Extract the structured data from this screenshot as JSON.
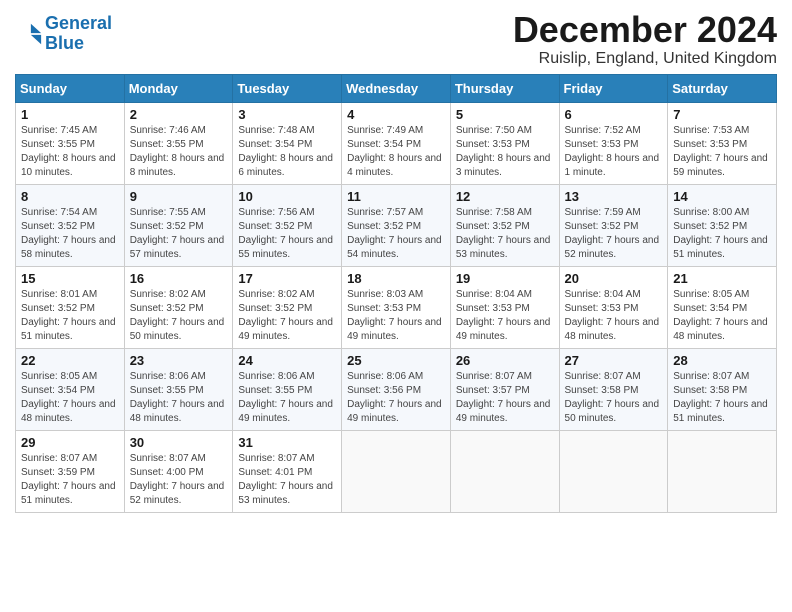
{
  "logo": {
    "line1": "General",
    "line2": "Blue"
  },
  "title": "December 2024",
  "subtitle": "Ruislip, England, United Kingdom",
  "header": {
    "accent_color": "#2980b9"
  },
  "weekdays": [
    "Sunday",
    "Monday",
    "Tuesday",
    "Wednesday",
    "Thursday",
    "Friday",
    "Saturday"
  ],
  "weeks": [
    [
      {
        "day": "1",
        "sunrise": "7:45 AM",
        "sunset": "3:55 PM",
        "daylight": "8 hours and 10 minutes."
      },
      {
        "day": "2",
        "sunrise": "7:46 AM",
        "sunset": "3:55 PM",
        "daylight": "8 hours and 8 minutes."
      },
      {
        "day": "3",
        "sunrise": "7:48 AM",
        "sunset": "3:54 PM",
        "daylight": "8 hours and 6 minutes."
      },
      {
        "day": "4",
        "sunrise": "7:49 AM",
        "sunset": "3:54 PM",
        "daylight": "8 hours and 4 minutes."
      },
      {
        "day": "5",
        "sunrise": "7:50 AM",
        "sunset": "3:53 PM",
        "daylight": "8 hours and 3 minutes."
      },
      {
        "day": "6",
        "sunrise": "7:52 AM",
        "sunset": "3:53 PM",
        "daylight": "8 hours and 1 minute."
      },
      {
        "day": "7",
        "sunrise": "7:53 AM",
        "sunset": "3:53 PM",
        "daylight": "7 hours and 59 minutes."
      }
    ],
    [
      {
        "day": "8",
        "sunrise": "7:54 AM",
        "sunset": "3:52 PM",
        "daylight": "7 hours and 58 minutes."
      },
      {
        "day": "9",
        "sunrise": "7:55 AM",
        "sunset": "3:52 PM",
        "daylight": "7 hours and 57 minutes."
      },
      {
        "day": "10",
        "sunrise": "7:56 AM",
        "sunset": "3:52 PM",
        "daylight": "7 hours and 55 minutes."
      },
      {
        "day": "11",
        "sunrise": "7:57 AM",
        "sunset": "3:52 PM",
        "daylight": "7 hours and 54 minutes."
      },
      {
        "day": "12",
        "sunrise": "7:58 AM",
        "sunset": "3:52 PM",
        "daylight": "7 hours and 53 minutes."
      },
      {
        "day": "13",
        "sunrise": "7:59 AM",
        "sunset": "3:52 PM",
        "daylight": "7 hours and 52 minutes."
      },
      {
        "day": "14",
        "sunrise": "8:00 AM",
        "sunset": "3:52 PM",
        "daylight": "7 hours and 51 minutes."
      }
    ],
    [
      {
        "day": "15",
        "sunrise": "8:01 AM",
        "sunset": "3:52 PM",
        "daylight": "7 hours and 51 minutes."
      },
      {
        "day": "16",
        "sunrise": "8:02 AM",
        "sunset": "3:52 PM",
        "daylight": "7 hours and 50 minutes."
      },
      {
        "day": "17",
        "sunrise": "8:02 AM",
        "sunset": "3:52 PM",
        "daylight": "7 hours and 49 minutes."
      },
      {
        "day": "18",
        "sunrise": "8:03 AM",
        "sunset": "3:53 PM",
        "daylight": "7 hours and 49 minutes."
      },
      {
        "day": "19",
        "sunrise": "8:04 AM",
        "sunset": "3:53 PM",
        "daylight": "7 hours and 49 minutes."
      },
      {
        "day": "20",
        "sunrise": "8:04 AM",
        "sunset": "3:53 PM",
        "daylight": "7 hours and 48 minutes."
      },
      {
        "day": "21",
        "sunrise": "8:05 AM",
        "sunset": "3:54 PM",
        "daylight": "7 hours and 48 minutes."
      }
    ],
    [
      {
        "day": "22",
        "sunrise": "8:05 AM",
        "sunset": "3:54 PM",
        "daylight": "7 hours and 48 minutes."
      },
      {
        "day": "23",
        "sunrise": "8:06 AM",
        "sunset": "3:55 PM",
        "daylight": "7 hours and 48 minutes."
      },
      {
        "day": "24",
        "sunrise": "8:06 AM",
        "sunset": "3:55 PM",
        "daylight": "7 hours and 49 minutes."
      },
      {
        "day": "25",
        "sunrise": "8:06 AM",
        "sunset": "3:56 PM",
        "daylight": "7 hours and 49 minutes."
      },
      {
        "day": "26",
        "sunrise": "8:07 AM",
        "sunset": "3:57 PM",
        "daylight": "7 hours and 49 minutes."
      },
      {
        "day": "27",
        "sunrise": "8:07 AM",
        "sunset": "3:58 PM",
        "daylight": "7 hours and 50 minutes."
      },
      {
        "day": "28",
        "sunrise": "8:07 AM",
        "sunset": "3:58 PM",
        "daylight": "7 hours and 51 minutes."
      }
    ],
    [
      {
        "day": "29",
        "sunrise": "8:07 AM",
        "sunset": "3:59 PM",
        "daylight": "7 hours and 51 minutes."
      },
      {
        "day": "30",
        "sunrise": "8:07 AM",
        "sunset": "4:00 PM",
        "daylight": "7 hours and 52 minutes."
      },
      {
        "day": "31",
        "sunrise": "8:07 AM",
        "sunset": "4:01 PM",
        "daylight": "7 hours and 53 minutes."
      },
      null,
      null,
      null,
      null
    ]
  ]
}
